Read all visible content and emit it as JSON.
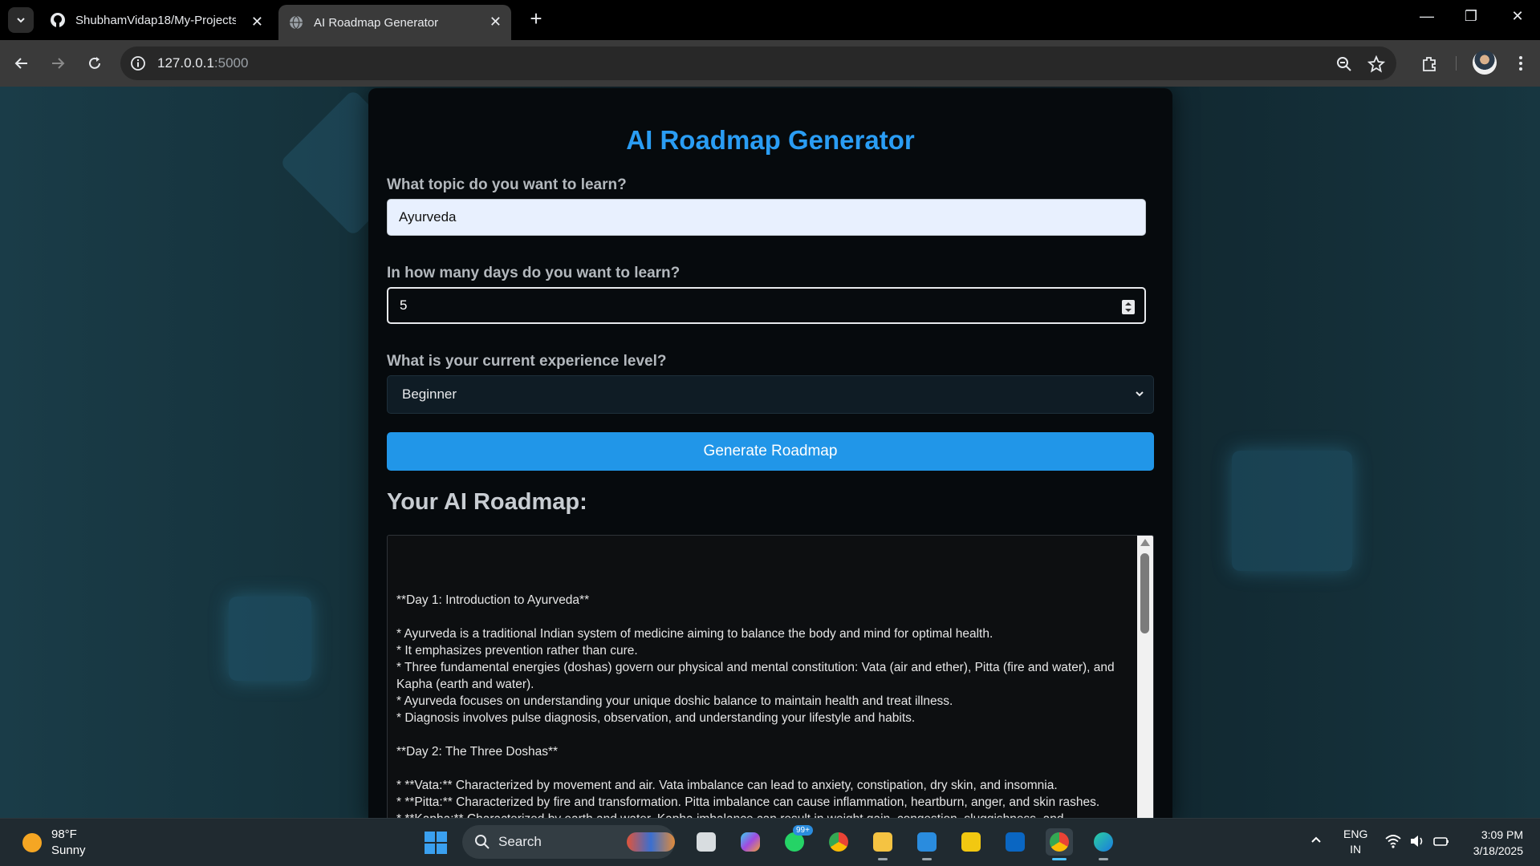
{
  "browser": {
    "tabs": [
      {
        "title": "ShubhamVidap18/My-Projects:",
        "active": false,
        "favicon": "github-icon"
      },
      {
        "title": "AI Roadmap Generator",
        "active": true,
        "favicon": "globe-icon"
      }
    ],
    "url_host": "127.0.0.1",
    "url_port": ":5000"
  },
  "app": {
    "title": "AI Roadmap Generator",
    "topic_label": "What topic do you want to learn?",
    "topic_value": "Ayurveda",
    "days_label": "In how many days do you want to learn?",
    "days_value": "5",
    "level_label": "What is your current experience level?",
    "level_selected": "Beginner",
    "generate_button": "Generate Roadmap",
    "roadmap_heading": "Your AI Roadmap:",
    "roadmap_lines": [
      "**Day 1: Introduction to Ayurveda**",
      "",
      "* Ayurveda is a traditional Indian system of medicine aiming to balance the body and mind for optimal health.",
      "* It emphasizes prevention rather than cure.",
      "*  Three fundamental energies (doshas) govern our physical and mental constitution: Vata (air and ether), Pitta (fire and water), and Kapha (earth and water).",
      "*  Ayurveda focuses on understanding your unique doshic balance to maintain health and treat illness.",
      "*  Diagnosis involves pulse diagnosis, observation, and understanding your lifestyle and habits.",
      "",
      "**Day 2: The Three Doshas**",
      "",
      "* **Vata:** Characterized by movement and air.  Vata imbalance can lead to anxiety, constipation, dry skin, and insomnia.",
      "* **Pitta:** Characterized by fire and transformation. Pitta imbalance can cause inflammation, heartburn, anger, and skin rashes.",
      "* **Kapha:** Characterized by earth and water. Kapha imbalance can result in weight gain, congestion, sluggishness, and"
    ]
  },
  "taskbar": {
    "weather_temp": "98°F",
    "weather_desc": "Sunny",
    "search_label": "Search",
    "whatsapp_badge": "99+",
    "lang_line1": "ENG",
    "lang_line2": "IN",
    "time": "3:09 PM",
    "date": "3/18/2025"
  },
  "colors": {
    "accent": "#2196e8",
    "title_blue": "#2a9df4",
    "card_bg": "#060a0d"
  }
}
